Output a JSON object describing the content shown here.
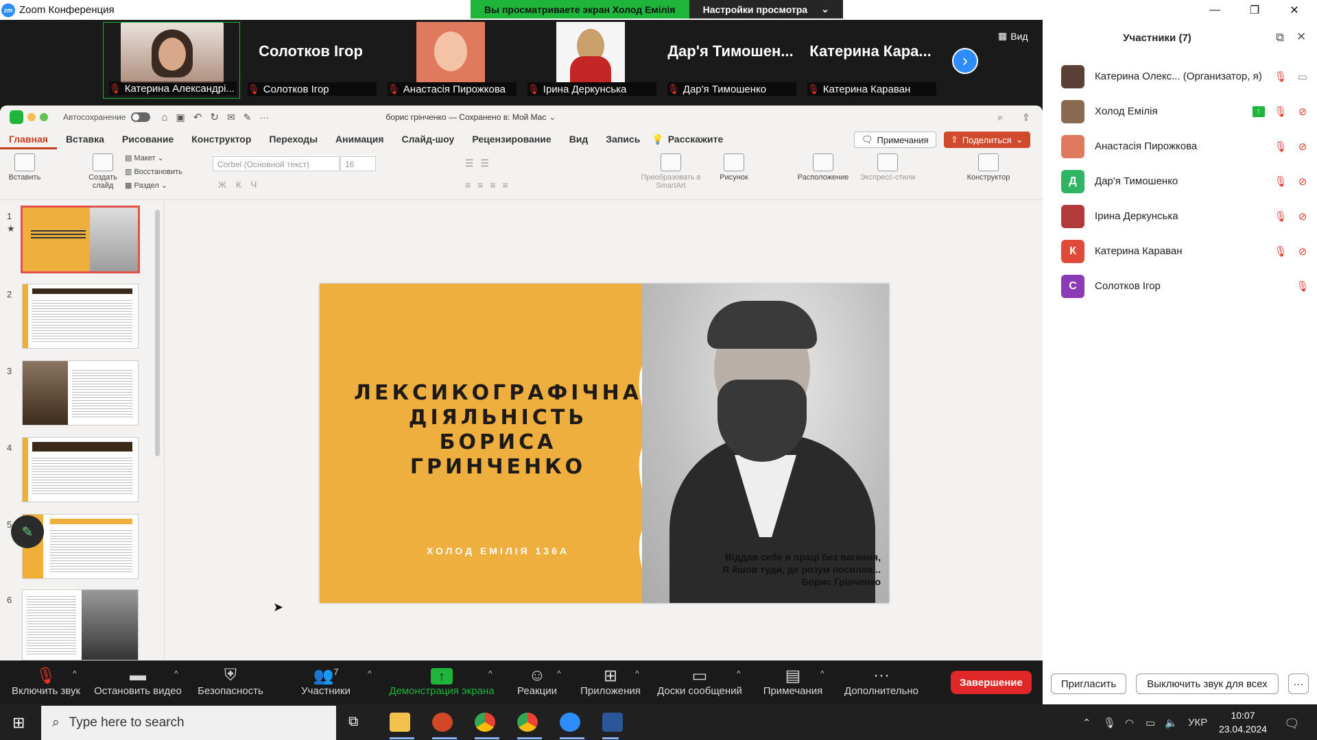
{
  "window": {
    "title": "Zoom Конференция"
  },
  "share_banner": {
    "viewing": "Вы просматриваете экран Холод Емілія",
    "view_settings": "Настройки просмотра"
  },
  "gallery": {
    "tiles": [
      {
        "label": "Катерина Александрі...",
        "big": ""
      },
      {
        "label": "Солотков Ігор",
        "big": "Солотков Ігор"
      },
      {
        "label": "Анастасія Пирожкова",
        "big": ""
      },
      {
        "label": "Ірина Деркунська",
        "big": ""
      },
      {
        "label": "Дар'я Тимошенко",
        "big": "Дар'я Тимошен..."
      },
      {
        "label": "Катерина Караван",
        "big": "Катерина Кара..."
      }
    ],
    "view_label": "Вид"
  },
  "ppt": {
    "autosave": "Автосохранение",
    "doc_title": "борис грінченко — Сохранено в: Мой Mac",
    "tabs": [
      "Главная",
      "Вставка",
      "Рисование",
      "Конструктор",
      "Переходы",
      "Анимация",
      "Слайд-шоу",
      "Рецензирование",
      "Вид",
      "Запись",
      "Расскажите"
    ],
    "notes_btn": "Примечания",
    "share_btn": "Поделиться",
    "ribbon": {
      "paste": "Вставить",
      "new_slide": "Создать слайд",
      "layout": "Макет",
      "reset": "Восстановить",
      "section": "Раздел",
      "font": "Corbel (Основной текст)",
      "size": "16",
      "smartart": "Преобразовать в SmartArt",
      "picture": "Рисунок",
      "arrange": "Расположение",
      "quick_styles": "Экспресс-стили",
      "designer": "Конструктор"
    },
    "thumbs": [
      "1",
      "2",
      "3",
      "4",
      "5",
      "6"
    ],
    "slide": {
      "title_lines": [
        "ЛЕКСИКОГРАФІЧНА",
        "ДІЯЛЬНІСТЬ",
        "БОРИСА ГРИНЧЕНКО"
      ],
      "author": "ХОЛОД ЕМІЛІЯ 136А",
      "quote_lines": [
        "Віддав себе я праці без вагання,",
        "Я йшов туди, де розум посилав...",
        "Борис Грінченко"
      ]
    }
  },
  "toolbar": {
    "items": [
      "Включить звук",
      "Остановить видео",
      "Безопасность",
      "Участники",
      "Демонстрация экрана",
      "Реакции",
      "Приложения",
      "Доски сообщений",
      "Примечания",
      "Дополнительно"
    ],
    "participants_count": "7",
    "end": "Завершение"
  },
  "panel": {
    "title": "Участники (7)",
    "participants": [
      {
        "name": "Катерина Олекс... (Организатор, я)",
        "initial": "",
        "color": "#6b4c3b"
      },
      {
        "name": "Холод Емілія",
        "initial": "",
        "color": "#8a6a50"
      },
      {
        "name": "Анастасія Пирожкова",
        "initial": "",
        "color": "#e07a5f"
      },
      {
        "name": "Дар'я Тимошенко",
        "initial": "Д",
        "color": "#2fb463"
      },
      {
        "name": "Ірина Деркунська",
        "initial": "",
        "color": "#b33a3a"
      },
      {
        "name": "Катерина Караван",
        "initial": "К",
        "color": "#e04a3a"
      },
      {
        "name": "Солотков Ігор",
        "initial": "С",
        "color": "#8a3bb5"
      }
    ],
    "invite": "Пригласить",
    "mute_all": "Выключить звук для всех"
  },
  "taskbar": {
    "search_placeholder": "Type here to search",
    "lang": "УКР",
    "time": "10:07",
    "date": "23.04.2024"
  }
}
